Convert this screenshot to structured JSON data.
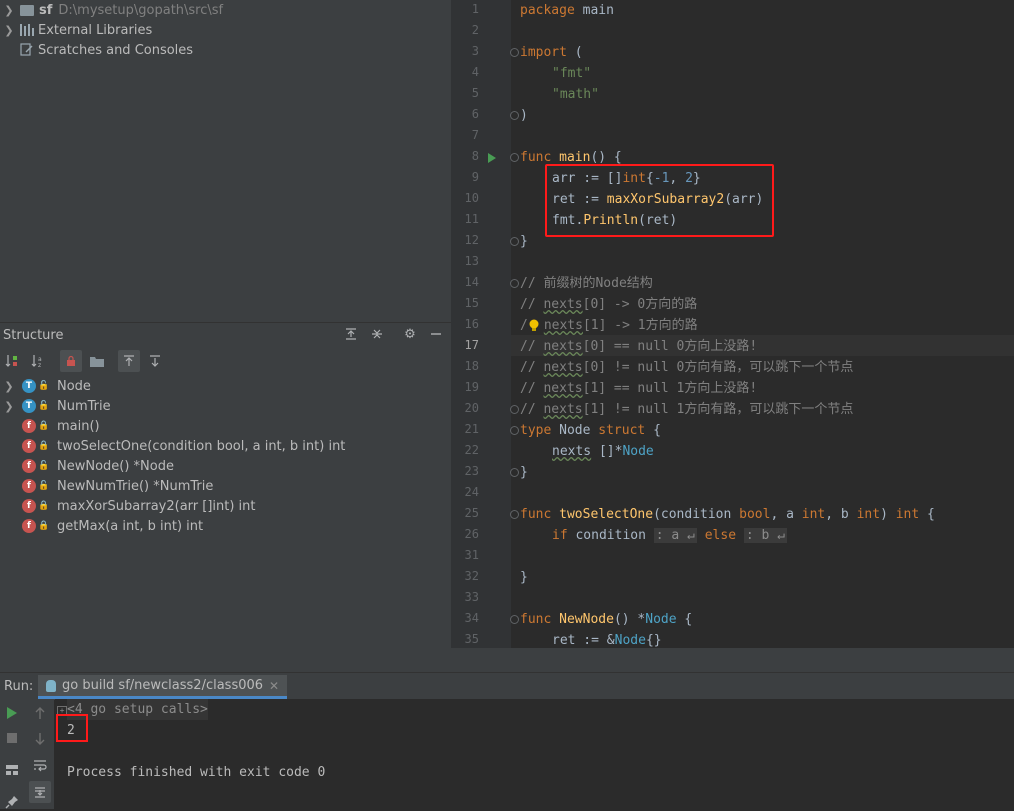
{
  "project_tree": [
    {
      "name": "sf",
      "path": "D:\\mysetup\\gopath\\src\\sf",
      "icon": "folder-icon"
    },
    {
      "name": "External Libraries",
      "icon": "libraries-icon"
    },
    {
      "name": "Scratches and Consoles",
      "icon": "scratches-icon"
    }
  ],
  "structure": {
    "title": "Structure",
    "items": [
      {
        "kind": "T",
        "name": "Node",
        "expandable": true
      },
      {
        "kind": "T",
        "name": "NumTrie",
        "expandable": true
      },
      {
        "kind": "f",
        "name": "main()"
      },
      {
        "kind": "f",
        "name": "twoSelectOne(condition bool, a int, b int) int"
      },
      {
        "kind": "f",
        "name": "NewNode() *Node"
      },
      {
        "kind": "f",
        "name": "NewNumTrie() *NumTrie"
      },
      {
        "kind": "f",
        "name": "maxXorSubarray2(arr []int) int"
      },
      {
        "kind": "f",
        "name": "getMax(a int, b int) int"
      }
    ]
  },
  "editor": {
    "line_numbers": [
      "1",
      "2",
      "3",
      "4",
      "5",
      "6",
      "7",
      "8",
      "9",
      "10",
      "11",
      "12",
      "13",
      "14",
      "15",
      "16",
      "17",
      "18",
      "19",
      "20",
      "21",
      "22",
      "23",
      "24",
      "25",
      "26",
      "31",
      "32",
      "33",
      "34",
      "35"
    ],
    "current_line": "17",
    "code": {
      "l1a": "package",
      "l1b": " main",
      "l3a": "import",
      "l3b": " (",
      "l4": "\"fmt\"",
      "l5": "\"math\"",
      "l6": ")",
      "l8a": "func",
      "l8b": " main",
      "l8c": "() {",
      "l9a": "arr := []",
      "l9b": "int",
      "l9c": "{",
      "l9d": "-1",
      "l9e": ", ",
      "l9f": "2",
      "l9g": "}",
      "l10a": "ret := ",
      "l10b": "maxXorSubarray2",
      "l10c": "(arr)",
      "l11a": "fmt.",
      "l11b": "Println",
      "l11c": "(ret)",
      "l12": "}",
      "l14": "// 前缀树的Node结构",
      "l15a": "// ",
      "l15b": "nexts",
      "l15c": "[0] -> 0方向的路",
      "l16a": "/",
      "l16b": "nexts",
      "l16c": "[1] -> 1方向的路",
      "l17a": "// ",
      "l17b": "nexts",
      "l17c": "[0] == null 0方向上没路!",
      "l18a": "// ",
      "l18b": "nexts",
      "l18c": "[0] != null 0方向有路，可以跳下一个节点",
      "l19a": "// ",
      "l19b": "nexts",
      "l19c": "[1] == null 1方向上没路!",
      "l20a": "// ",
      "l20b": "nexts",
      "l20c": "[1] != null 1方向有路，可以跳下一个节点",
      "l21a": "type",
      "l21b": " Node ",
      "l21c": "struct",
      "l21d": " {",
      "l22a": "nexts",
      "l22b": " []*",
      "l22c": "Node",
      "l23": "}",
      "l25a": "func",
      "l25b": " twoSelectOne",
      "l25c": "(condition ",
      "l25d": "bool",
      "l25e": ", a ",
      "l25f": "int",
      "l25g": ", b ",
      "l25h": "int",
      "l25i": ") ",
      "l25j": "int",
      "l25k": " {",
      "l26a": "if",
      "l26b": " condition ",
      "l26c": ": a ↵",
      "l26d": " else ",
      "l26e": ": b ↵",
      "l32": "}",
      "l34a": "func",
      "l34b": " NewNode",
      "l34c": "() *",
      "l34d": "Node",
      "l34e": " {",
      "l35a": "ret := &",
      "l35b": "Node",
      "l35c": "{}"
    }
  },
  "run": {
    "label": "Run:",
    "tab_title": "go build sf/newclass2/class006",
    "console": {
      "setup_calls": "<4 go setup calls>",
      "output": "2",
      "finish": "Process finished with exit code 0"
    }
  },
  "colors": {
    "highlight_border": "#ff1a1a",
    "keyword": "#cc7832",
    "function": "#ffc66d",
    "string": "#6a8759",
    "number": "#6897bb",
    "comment": "#808080"
  }
}
